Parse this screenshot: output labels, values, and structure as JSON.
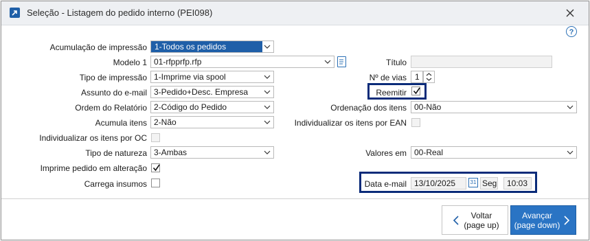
{
  "window": {
    "title": "Seleção - Listagem do pedido interno (PEI098)"
  },
  "form": {
    "acumulacao": {
      "label": "Acumulação de impressão",
      "value": "1-Todos os pedidos"
    },
    "modelo": {
      "label": "Modelo 1",
      "value": "01-rfpprfp.rfp"
    },
    "titulo": {
      "label": "Título",
      "value": ""
    },
    "tipo_impressao": {
      "label": "Tipo de impressão",
      "value": "1-Imprime via spool"
    },
    "n_vias": {
      "label": "Nº de vias",
      "value": "1"
    },
    "assunto": {
      "label": "Assunto do e-mail",
      "value": "3-Pedido+Desc. Empresa"
    },
    "reemitir": {
      "label": "Reemitir",
      "checked": true
    },
    "ordem": {
      "label": "Ordem do Relatório",
      "value": "2-Código do Pedido"
    },
    "ordenacao": {
      "label": "Ordenação dos itens",
      "value": "00-Não"
    },
    "acumula_itens": {
      "label": "Acumula itens",
      "value": "2-Não"
    },
    "individualizar_ean": {
      "label": "Individualizar os itens por EAN",
      "checked": false
    },
    "individualizar_oc": {
      "label": "Individualizar os itens por OC",
      "checked": false
    },
    "tipo_natureza": {
      "label": "Tipo de natureza",
      "value": "3-Ambas"
    },
    "valores_em": {
      "label": "Valores em",
      "value": "00-Real"
    },
    "imprime_alteracao": {
      "label": "Imprime pedido em alteração",
      "checked": true
    },
    "carrega_insumos": {
      "label": "Carrega insumos",
      "checked": false
    },
    "data_email": {
      "label": "Data e-mail",
      "date": "13/10/2025",
      "weekday": "Seg",
      "time": "10:03"
    }
  },
  "buttons": {
    "back": {
      "line1": "Voltar",
      "line2": "(page up)"
    },
    "next": {
      "line1": "Avançar",
      "line2": "(page down)"
    }
  },
  "colors": {
    "accent": "#2a74c4",
    "highlight_frame": "#0a2b79",
    "selection": "#1f5fa8"
  }
}
